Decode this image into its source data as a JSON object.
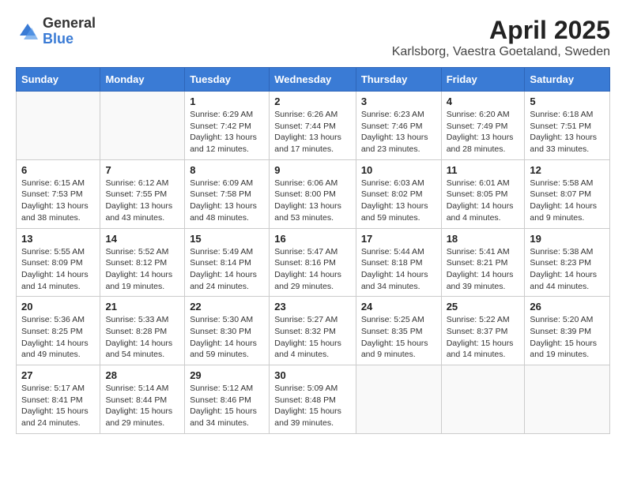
{
  "header": {
    "logo": {
      "general": "General",
      "blue": "Blue"
    },
    "title": "April 2025",
    "subtitle": "Karlsborg, Vaestra Goetaland, Sweden"
  },
  "calendar": {
    "days_of_week": [
      "Sunday",
      "Monday",
      "Tuesday",
      "Wednesday",
      "Thursday",
      "Friday",
      "Saturday"
    ],
    "weeks": [
      [
        {
          "day": "",
          "info": ""
        },
        {
          "day": "",
          "info": ""
        },
        {
          "day": "1",
          "info": "Sunrise: 6:29 AM\nSunset: 7:42 PM\nDaylight: 13 hours and 12 minutes."
        },
        {
          "day": "2",
          "info": "Sunrise: 6:26 AM\nSunset: 7:44 PM\nDaylight: 13 hours and 17 minutes."
        },
        {
          "day": "3",
          "info": "Sunrise: 6:23 AM\nSunset: 7:46 PM\nDaylight: 13 hours and 23 minutes."
        },
        {
          "day": "4",
          "info": "Sunrise: 6:20 AM\nSunset: 7:49 PM\nDaylight: 13 hours and 28 minutes."
        },
        {
          "day": "5",
          "info": "Sunrise: 6:18 AM\nSunset: 7:51 PM\nDaylight: 13 hours and 33 minutes."
        }
      ],
      [
        {
          "day": "6",
          "info": "Sunrise: 6:15 AM\nSunset: 7:53 PM\nDaylight: 13 hours and 38 minutes."
        },
        {
          "day": "7",
          "info": "Sunrise: 6:12 AM\nSunset: 7:55 PM\nDaylight: 13 hours and 43 minutes."
        },
        {
          "day": "8",
          "info": "Sunrise: 6:09 AM\nSunset: 7:58 PM\nDaylight: 13 hours and 48 minutes."
        },
        {
          "day": "9",
          "info": "Sunrise: 6:06 AM\nSunset: 8:00 PM\nDaylight: 13 hours and 53 minutes."
        },
        {
          "day": "10",
          "info": "Sunrise: 6:03 AM\nSunset: 8:02 PM\nDaylight: 13 hours and 59 minutes."
        },
        {
          "day": "11",
          "info": "Sunrise: 6:01 AM\nSunset: 8:05 PM\nDaylight: 14 hours and 4 minutes."
        },
        {
          "day": "12",
          "info": "Sunrise: 5:58 AM\nSunset: 8:07 PM\nDaylight: 14 hours and 9 minutes."
        }
      ],
      [
        {
          "day": "13",
          "info": "Sunrise: 5:55 AM\nSunset: 8:09 PM\nDaylight: 14 hours and 14 minutes."
        },
        {
          "day": "14",
          "info": "Sunrise: 5:52 AM\nSunset: 8:12 PM\nDaylight: 14 hours and 19 minutes."
        },
        {
          "day": "15",
          "info": "Sunrise: 5:49 AM\nSunset: 8:14 PM\nDaylight: 14 hours and 24 minutes."
        },
        {
          "day": "16",
          "info": "Sunrise: 5:47 AM\nSunset: 8:16 PM\nDaylight: 14 hours and 29 minutes."
        },
        {
          "day": "17",
          "info": "Sunrise: 5:44 AM\nSunset: 8:18 PM\nDaylight: 14 hours and 34 minutes."
        },
        {
          "day": "18",
          "info": "Sunrise: 5:41 AM\nSunset: 8:21 PM\nDaylight: 14 hours and 39 minutes."
        },
        {
          "day": "19",
          "info": "Sunrise: 5:38 AM\nSunset: 8:23 PM\nDaylight: 14 hours and 44 minutes."
        }
      ],
      [
        {
          "day": "20",
          "info": "Sunrise: 5:36 AM\nSunset: 8:25 PM\nDaylight: 14 hours and 49 minutes."
        },
        {
          "day": "21",
          "info": "Sunrise: 5:33 AM\nSunset: 8:28 PM\nDaylight: 14 hours and 54 minutes."
        },
        {
          "day": "22",
          "info": "Sunrise: 5:30 AM\nSunset: 8:30 PM\nDaylight: 14 hours and 59 minutes."
        },
        {
          "day": "23",
          "info": "Sunrise: 5:27 AM\nSunset: 8:32 PM\nDaylight: 15 hours and 4 minutes."
        },
        {
          "day": "24",
          "info": "Sunrise: 5:25 AM\nSunset: 8:35 PM\nDaylight: 15 hours and 9 minutes."
        },
        {
          "day": "25",
          "info": "Sunrise: 5:22 AM\nSunset: 8:37 PM\nDaylight: 15 hours and 14 minutes."
        },
        {
          "day": "26",
          "info": "Sunrise: 5:20 AM\nSunset: 8:39 PM\nDaylight: 15 hours and 19 minutes."
        }
      ],
      [
        {
          "day": "27",
          "info": "Sunrise: 5:17 AM\nSunset: 8:41 PM\nDaylight: 15 hours and 24 minutes."
        },
        {
          "day": "28",
          "info": "Sunrise: 5:14 AM\nSunset: 8:44 PM\nDaylight: 15 hours and 29 minutes."
        },
        {
          "day": "29",
          "info": "Sunrise: 5:12 AM\nSunset: 8:46 PM\nDaylight: 15 hours and 34 minutes."
        },
        {
          "day": "30",
          "info": "Sunrise: 5:09 AM\nSunset: 8:48 PM\nDaylight: 15 hours and 39 minutes."
        },
        {
          "day": "",
          "info": ""
        },
        {
          "day": "",
          "info": ""
        },
        {
          "day": "",
          "info": ""
        }
      ]
    ]
  }
}
